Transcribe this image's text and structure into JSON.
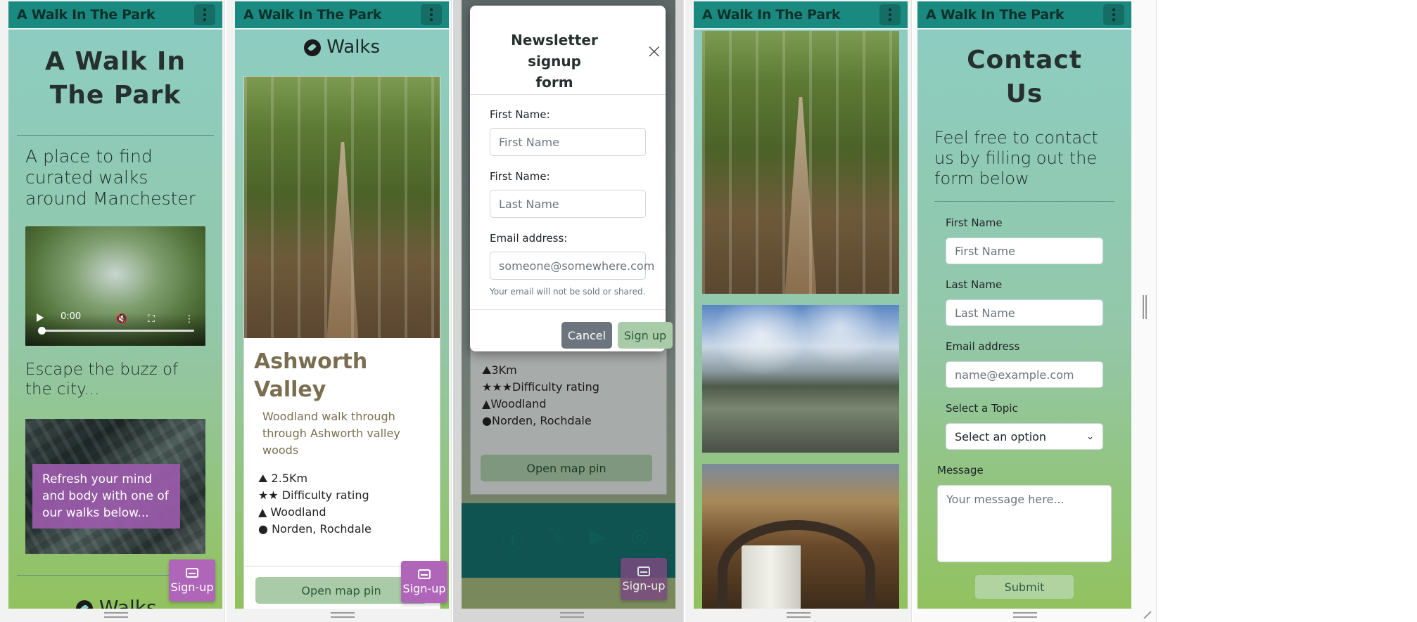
{
  "brand": "A Walk In The Park",
  "home": {
    "title_line1": "A Walk In",
    "title_line2": "The Park",
    "lead": "A place to find curated walks around Manchester",
    "video_time": "0:00",
    "escape": "Escape the buzz of the city...",
    "overlay": "Refresh your mind and body with one of our walks below...",
    "walks_heading": "Walks"
  },
  "signup_fab": {
    "label": "Sign-up",
    "icon": "inbox-icon"
  },
  "walk_page": {
    "heading": "Walks",
    "card_title": "Ashworth Valley",
    "card_text": "Woodland walk through through Ashworth valley woods",
    "distance": "2.5Km",
    "difficulty": "Difficulty rating",
    "terrain": "Woodland",
    "location": "Norden, Rochdale",
    "map_button": "Open map pin"
  },
  "modal": {
    "title_line1": "Newsletter signup",
    "title_line2": "form",
    "first_label": "First Name:",
    "first_placeholder": "First Name",
    "second_label": "First Name:",
    "second_placeholder": "Last Name",
    "email_label": "Email address:",
    "email_placeholder": "someone@somewhere.com",
    "email_help": "Your email will not be sold or shared.",
    "cancel": "Cancel",
    "submit": "Sign up",
    "behind_distance": "3Km",
    "behind_difficulty": "Difficulty rating",
    "behind_terrain": "Woodland",
    "behind_location": "Norden, Rochdale",
    "behind_map_button": "Open map pin"
  },
  "contact": {
    "title_line1": "Contact",
    "title_line2": "Us",
    "lead": "Feel free to contact us by filling out the form below",
    "first_label": "First Name",
    "first_placeholder": "First Name",
    "last_label": "Last Name",
    "last_placeholder": "Last Name",
    "email_label": "Email address",
    "email_placeholder": "name@example.com",
    "topic_label": "Select a Topic",
    "topic_value": "Select an option",
    "message_label": "Message",
    "message_placeholder": "Your message here...",
    "submit": "Submit"
  },
  "colors": {
    "navbar": "#1a8a80",
    "purple": "#b066b8",
    "map_button": "#a9cba8",
    "cancel": "#6c757d"
  }
}
